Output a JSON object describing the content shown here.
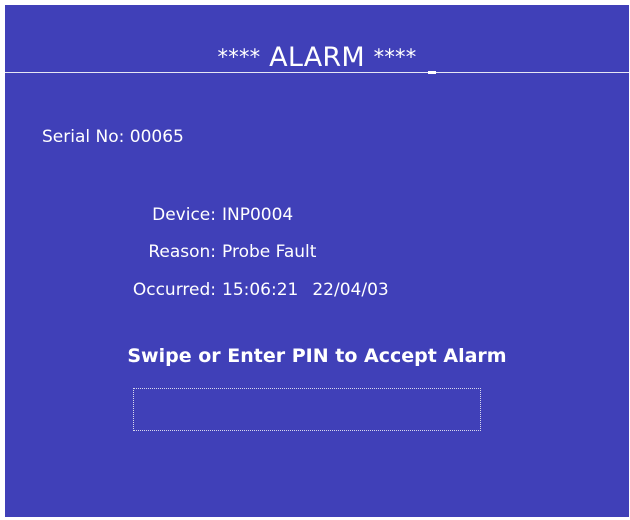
{
  "header": {
    "title_prefix": "****",
    "title_word": "ALARM",
    "title_suffix": "****"
  },
  "serial": {
    "label": "Serial No:",
    "value": "00065"
  },
  "details": [
    {
      "label": "Device:",
      "value": "INP0004"
    },
    {
      "label": "Reason:",
      "value": "Probe Fault"
    },
    {
      "label": "Occurred:",
      "time": "15:06:21",
      "date": "22/04/03"
    }
  ],
  "prompt": {
    "text": "Swipe or Enter PIN to Accept Alarm"
  },
  "pin_input": {
    "value": ""
  },
  "colors": {
    "background": "#4040b8",
    "text": "#ffffff"
  }
}
